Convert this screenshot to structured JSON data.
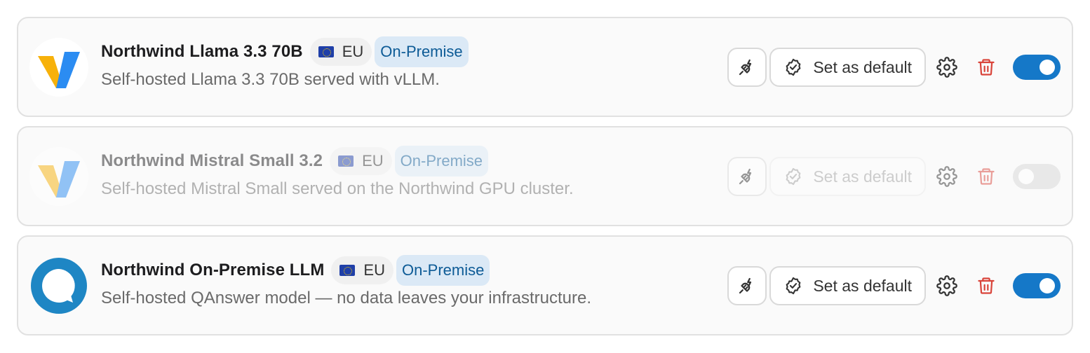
{
  "models": [
    {
      "title": "Northwind Llama 3.3 70B",
      "region": "EU",
      "hosting": "On-Premise",
      "description": "Self-hosted Llama 3.3 70B served with vLLM.",
      "logo": "v-logo",
      "enabled": true,
      "set_default_label": "Set as default"
    },
    {
      "title": "Northwind Mistral Small 3.2",
      "region": "EU",
      "hosting": "On-Premise",
      "description": "Self-hosted Mistral Small served on the Northwind GPU cluster.",
      "logo": "v-logo",
      "enabled": false,
      "set_default_label": "Set as default"
    },
    {
      "title": "Northwind On-Premise LLM",
      "region": "EU",
      "hosting": "On-Premise",
      "description": "Self-hosted QAnswer model — no data leaves your infrastructure.",
      "logo": "qanswer-logo",
      "enabled": true,
      "set_default_label": "Set as default"
    }
  ],
  "colors": {
    "accent": "#1578c8",
    "badge_bg": "#dbe9f6",
    "badge_text": "#0d5b96",
    "delete": "#d9443a",
    "toggle_off": "#d7d7d7"
  },
  "icons": {
    "test_connection": "plug-icon",
    "set_default": "check-circle-icon",
    "settings": "gear-icon",
    "delete": "trash-icon"
  }
}
